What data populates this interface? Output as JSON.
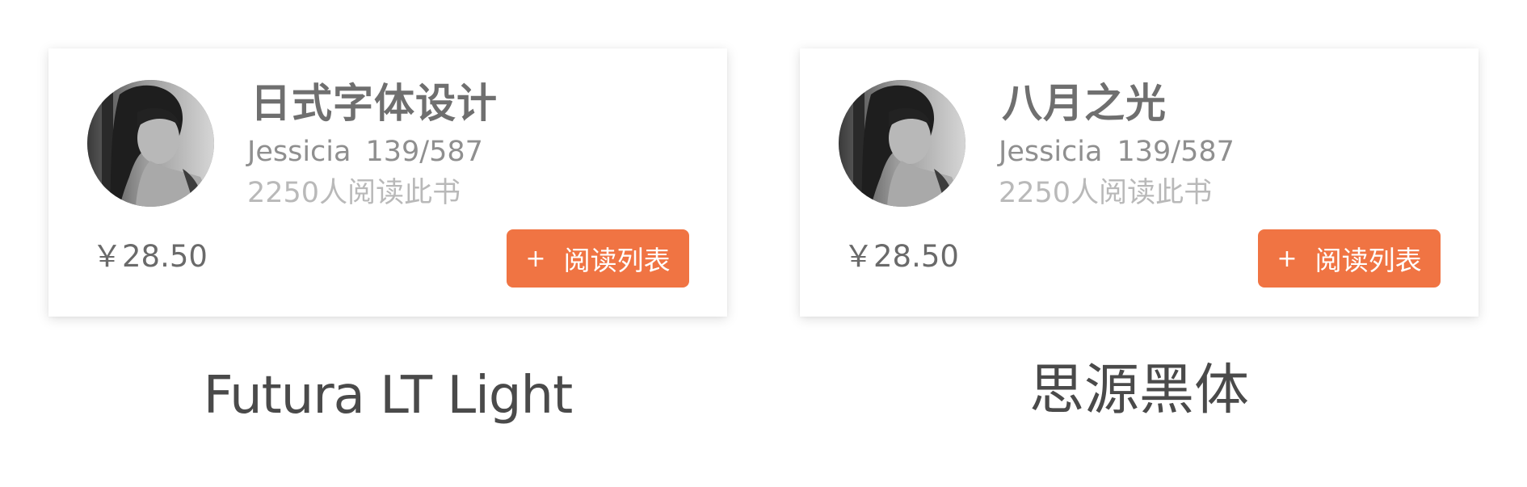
{
  "cards": [
    {
      "title": "日式字体设计",
      "author": "Jessicia",
      "progress": "139/587",
      "readers": "2250人阅读此书",
      "price": "￥28.50",
      "button_plus": "+",
      "button_label": "阅读列表",
      "caption": "Futura LT Light"
    },
    {
      "title": "八月之光",
      "author": "Jessicia",
      "progress": "139/587",
      "readers": "2250人阅读此书",
      "price": "￥28.50",
      "button_plus": "+",
      "button_label": "阅读列表",
      "caption": "思源黑体"
    }
  ],
  "colors": {
    "accent": "#f07443",
    "title": "#6f6f6f",
    "meta": "#8f8f8f",
    "readers": "#b9b9b9",
    "caption": "#4a4a4a"
  },
  "icons": {
    "avatar": "user-photo",
    "button": "plus-icon"
  }
}
